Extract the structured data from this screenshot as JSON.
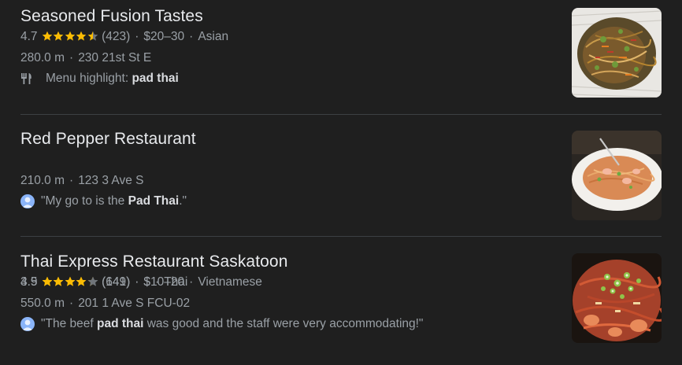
{
  "results": [
    {
      "name": "Seasoned Fusion Tastes",
      "rating": "4.7",
      "rating_value": 4.7,
      "reviews": "(423)",
      "price": "$20–30",
      "cuisine": "Asian",
      "distance": "280.0 m",
      "address": "230 21st St E",
      "detail_prefix": "Menu highlight: ",
      "detail_bold": "pad thai",
      "detail_suffix": "",
      "detail_icon": "utensils-icon"
    },
    {
      "name": "Red Pepper Restaurant",
      "rating": "4.5",
      "rating_value": 4.5,
      "reviews": "(641)",
      "price": "$10–20",
      "cuisine": "Vietnamese",
      "distance": "210.0 m",
      "address": "123 3 Ave S",
      "detail_prefix": "\"My go to is the ",
      "detail_bold": "Pad Thai",
      "detail_suffix": ".\"",
      "detail_icon": "user-avatar-icon"
    },
    {
      "name": "Thai Express Restaurant Saskatoon",
      "rating": "3.9",
      "rating_value": 3.9,
      "reviews": "(149)",
      "price": "$",
      "cuisine": "Thai",
      "distance": "550.0 m",
      "address": "201 1 Ave S FCU-02",
      "detail_prefix": "\"The beef ",
      "detail_bold": "pad thai",
      "detail_suffix": " was good and the staff were very accommodating!\"",
      "detail_icon": "user-avatar-icon"
    }
  ],
  "separator": "·",
  "colors": {
    "background": "#1f1f1f",
    "title": "#e8eaed",
    "secondary": "#9aa0a6",
    "star_filled": "#fbbc04",
    "star_empty": "#70757a",
    "avatar": "#8ab4f8"
  }
}
